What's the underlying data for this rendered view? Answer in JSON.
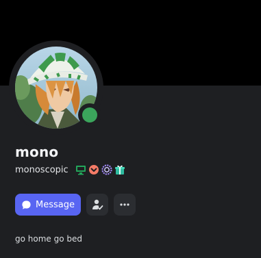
{
  "profile": {
    "display_name": "mono",
    "username": "monoscopic",
    "about": "go home go bed",
    "status": "online",
    "badges": [
      "active-developer-icon",
      "nitro-boost-icon",
      "hypesquad-icon",
      "gift-icon"
    ]
  },
  "actions": {
    "message_label": "Message",
    "add_friend_icon": "add-friend-icon",
    "more_icon": "more-options-icon"
  },
  "colors": {
    "background": "#1e1f22",
    "banner": "#000000",
    "accent": "#5865f2",
    "online": "#3ba55c"
  }
}
